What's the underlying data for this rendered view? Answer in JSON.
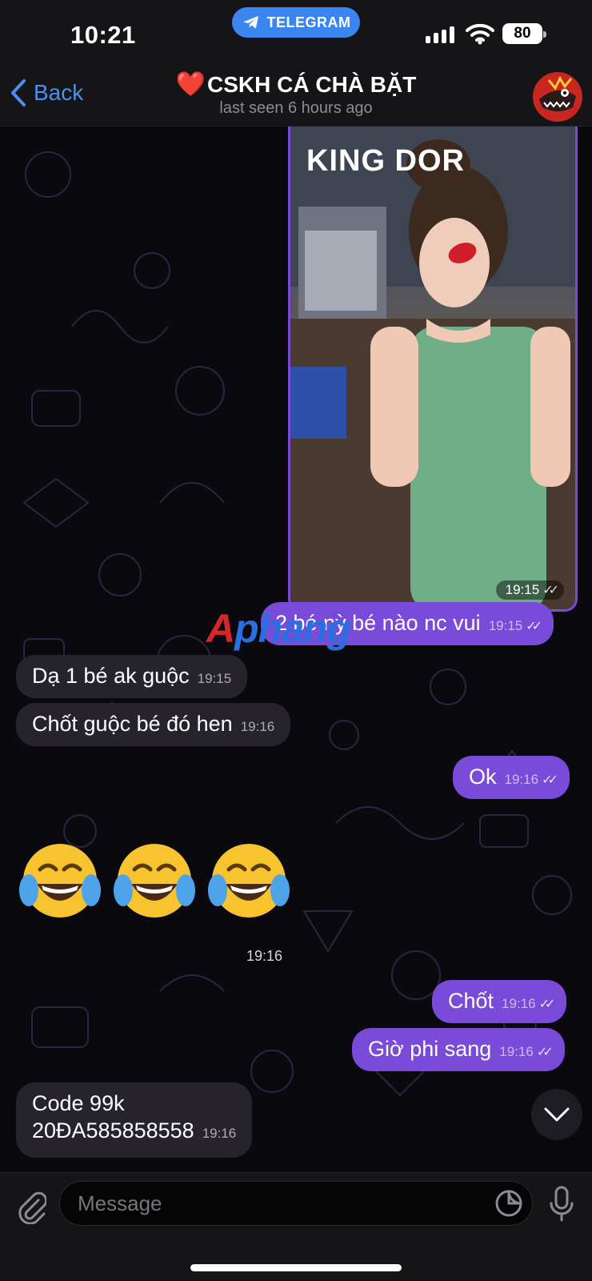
{
  "status_bar": {
    "time": "10:21",
    "app_pill": "TELEGRAM",
    "battery": "80"
  },
  "header": {
    "back_label": "Back",
    "heart": "❤️",
    "title": "CSKH CÁ CHÀ BẶT",
    "subtitle": "last seen 6 hours ago"
  },
  "photo_message": {
    "overlay_text": "KING DOR",
    "time": "19:15"
  },
  "watermark": {
    "part1": "A",
    "part2": "phang"
  },
  "messages": [
    {
      "side": "out",
      "text": "2 bé nỳ bé nào nc vui",
      "time": "19:15",
      "read": true
    },
    {
      "side": "in",
      "text": "Dạ 1 bé ak guộc",
      "time": "19:15"
    },
    {
      "side": "in",
      "text": "Chốt guộc bé đó hen",
      "time": "19:16"
    },
    {
      "side": "out",
      "text": "Ok",
      "time": "19:16",
      "read": true
    },
    {
      "side": "out",
      "text": "Chốt",
      "time": "19:16",
      "read": true
    },
    {
      "side": "out",
      "text": "Giờ phi sang",
      "time": "19:16",
      "read": true
    },
    {
      "side": "in",
      "line1": "Code 99k",
      "line2": "20ĐA585858558",
      "time": "19:16"
    }
  ],
  "emoji_message": {
    "emojis": [
      "😂",
      "😂",
      "😂"
    ],
    "time": "19:16"
  },
  "checks_glyph": "✓✓",
  "input": {
    "placeholder": "Message"
  },
  "icons": [
    "telegram-plane-icon",
    "cellular-signal-icon",
    "wifi-icon",
    "battery-icon",
    "chevron-left-icon",
    "avatar-image",
    "chevron-down-icon",
    "paperclip-icon",
    "sticker-icon",
    "microphone-icon"
  ],
  "colors": {
    "outgoing_bubble": "#7a4ad9",
    "incoming_bubble": "#26232c",
    "link_blue": "#4a90f0",
    "pill_blue": "#3a86f0"
  }
}
